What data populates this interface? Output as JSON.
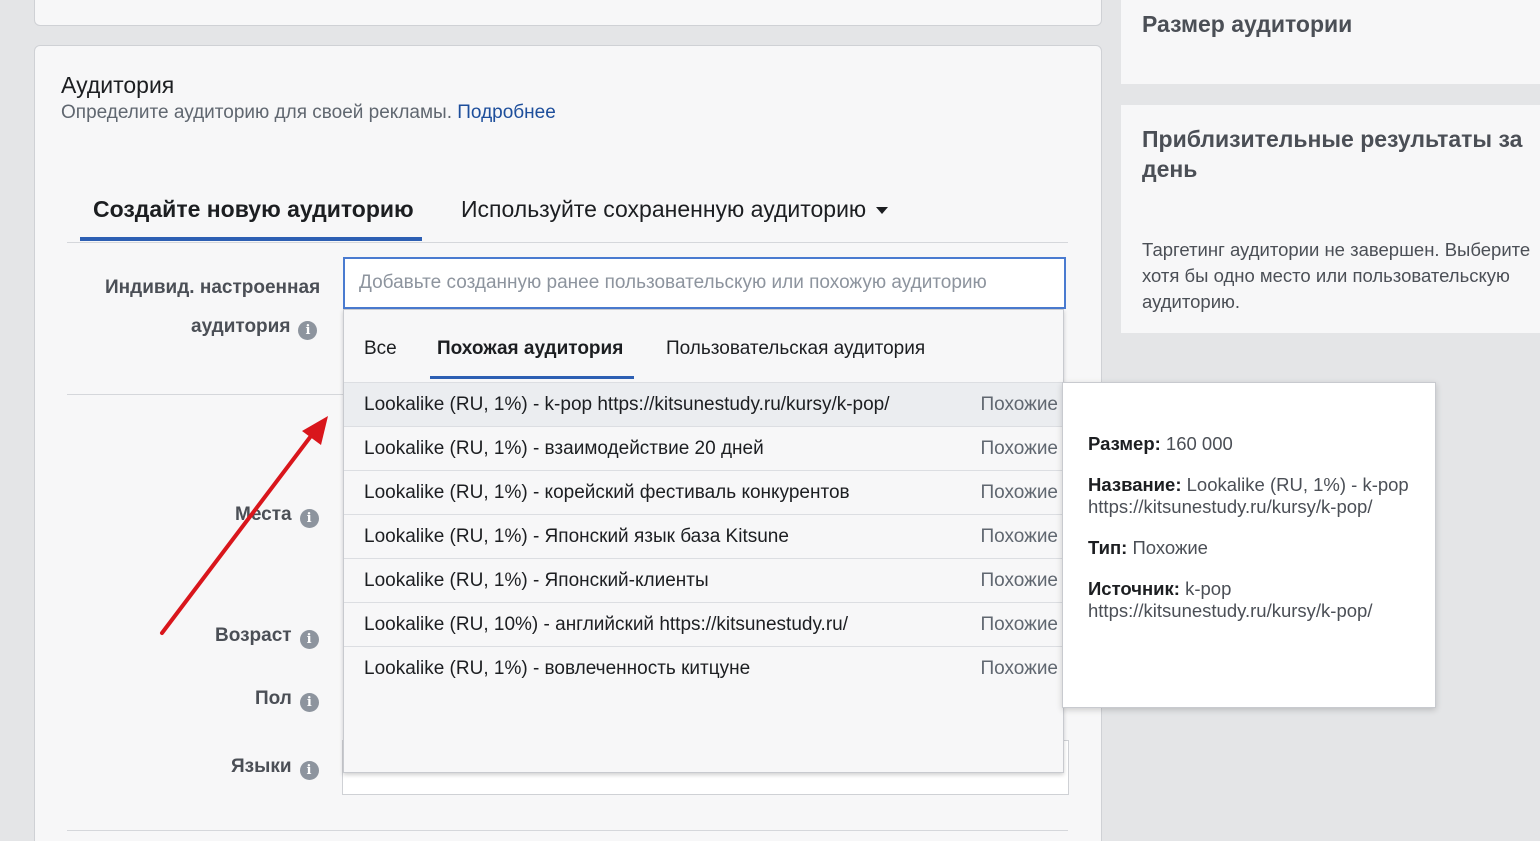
{
  "section": {
    "title": "Аудитория",
    "subtitle": "Определите аудиторию для своей рекламы.",
    "learn_more": "Подробнее"
  },
  "tabs": {
    "create": "Создайте новую аудиторию",
    "saved": "Используйте сохраненную аудиторию"
  },
  "fields": {
    "custom_audience_line1": "Индивид. настроенная",
    "custom_audience_line2": "аудитория",
    "locations": "Места",
    "age": "Возраст",
    "gender": "Пол",
    "languages": "Языки"
  },
  "audience_input": {
    "placeholder": "Добавьте созданную ранее пользовательскую или похожую аудиторию"
  },
  "dropdown": {
    "tabs": [
      "Все",
      "Похожая аудитория",
      "Пользовательская аудитория"
    ],
    "active_tab": "Похожая аудитория",
    "items": [
      {
        "name": "Lookalike (RU, 1%) - k-pop https://kitsunestudy.ru/kursy/k-pop/",
        "type": "Похожие"
      },
      {
        "name": "Lookalike (RU, 1%) - взаимодействие 20 дней",
        "type": "Похожие"
      },
      {
        "name": "Lookalike (RU, 1%) - корейский фестиваль конкурентов",
        "type": "Похожие"
      },
      {
        "name": "Lookalike (RU, 1%) - Японский язык база Kitsune",
        "type": "Похожие"
      },
      {
        "name": "Lookalike (RU, 1%) - Японский-клиенты",
        "type": "Похожие"
      },
      {
        "name": "Lookalike (RU, 10%) - английский https://kitsunestudy.ru/",
        "type": "Похожие"
      },
      {
        "name": "Lookalike (RU, 1%) - вовлеченность китцуне",
        "type": "Похожие"
      }
    ]
  },
  "tooltip": {
    "size_label": "Размер:",
    "size_value": "160 000",
    "name_label": "Название:",
    "name_value": "Lookalike (RU, 1%) - k-pop https://kitsunestudy.ru/kursy/k-pop/",
    "type_label": "Тип:",
    "type_value": "Похожие",
    "source_label": "Источник:",
    "source_value": "k-pop https://kitsunestudy.ru/kursy/k-pop/"
  },
  "sidebar": {
    "audience_size_title": "Размер аудитории",
    "results_title": "Приблизительные результаты за день",
    "results_text": "Таргетинг аудитории не завершен. Выберите хотя бы одно место или пользовательскую аудиторию."
  },
  "colors": {
    "accent": "#2d5fb3",
    "link": "#1d4e9b",
    "annotation_arrow": "#d9161c"
  }
}
